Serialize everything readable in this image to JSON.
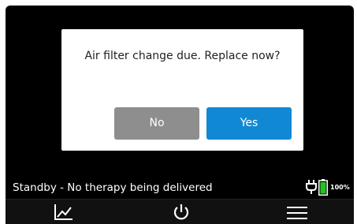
{
  "dialog": {
    "message": "Air filter change due. Replace now?",
    "no_label": "No",
    "yes_label": "Yes"
  },
  "status": {
    "text": "Standby - No therapy being delivered",
    "battery_percent": "100%"
  },
  "nav": {
    "items": [
      {
        "icon": "trend-chart-icon"
      },
      {
        "icon": "power-icon"
      },
      {
        "icon": "menu-icon"
      }
    ]
  },
  "colors": {
    "background": "#000000",
    "yes_button": "#1188d4",
    "no_button": "#8e8e8e",
    "battery": "#22c322"
  }
}
